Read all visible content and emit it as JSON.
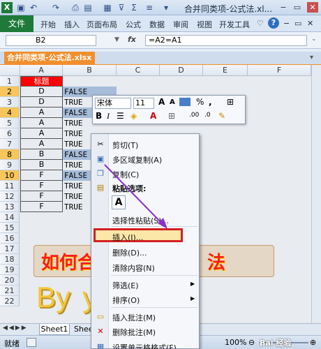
{
  "window": {
    "title": "合并同类项-公式法.xl...",
    "doc_tab": "合并同类项-公式法.xlsx"
  },
  "ribbon": {
    "file": "文件",
    "tabs": [
      "开始",
      "插入",
      "页面布局",
      "公式",
      "数据",
      "审阅",
      "视图",
      "开发工具"
    ]
  },
  "formula_bar": {
    "name_box": "B2",
    "fx": "fx",
    "formula": "=A2=A1"
  },
  "columns": [
    "A",
    "B",
    "C",
    "D",
    "E",
    "F"
  ],
  "rows": [
    {
      "n": "1",
      "a": "标题",
      "b": ""
    },
    {
      "n": "2",
      "a": "D",
      "b": "FALSE"
    },
    {
      "n": "3",
      "a": "D",
      "b": "TRUE"
    },
    {
      "n": "4",
      "a": "A",
      "b": "FALSE"
    },
    {
      "n": "5",
      "a": "A",
      "b": "TRUE"
    },
    {
      "n": "6",
      "a": "A",
      "b": "TRUE"
    },
    {
      "n": "7",
      "a": "A",
      "b": "TRUE"
    },
    {
      "n": "8",
      "a": "B",
      "b": "FALSE"
    },
    {
      "n": "9",
      "a": "B",
      "b": "TRUE"
    },
    {
      "n": "10",
      "a": "F",
      "b": "FALSE"
    },
    {
      "n": "11",
      "a": "F",
      "b": "TRUE"
    },
    {
      "n": "12",
      "a": "F",
      "b": "TRUE"
    },
    {
      "n": "13",
      "a": "F",
      "b": "TRUE"
    },
    {
      "n": "14",
      "a": "",
      "b": ""
    },
    {
      "n": "15",
      "a": "",
      "b": ""
    },
    {
      "n": "16",
      "a": "",
      "b": ""
    },
    {
      "n": "17",
      "a": "",
      "b": ""
    },
    {
      "n": "18",
      "a": "",
      "b": ""
    },
    {
      "n": "19",
      "a": "",
      "b": ""
    },
    {
      "n": "20",
      "a": "",
      "b": ""
    },
    {
      "n": "21",
      "a": "",
      "b": ""
    },
    {
      "n": "22",
      "a": "",
      "b": ""
    }
  ],
  "mini_toolbar": {
    "font": "宋体",
    "size": "11"
  },
  "context_menu": {
    "cut": "剪切(T)",
    "multi_copy": "多区域复制(A)",
    "copy": "复制(C)",
    "paste_options": "粘贴选项:",
    "paste_icon": "A",
    "paste_special": "选择性粘贴(S)...",
    "insert": "插入(I)...",
    "delete": "删除(D)...",
    "clear": "清除内容(N)",
    "filter": "筛选(E)",
    "sort": "排序(O)",
    "insert_comment": "插入批注(M)",
    "delete_comment": "删除批注(M)",
    "format_cells": "设置单元格格式(F)..."
  },
  "overlay": {
    "title": "如何合",
    "title_right": "法",
    "by": "By"
  },
  "sheets": {
    "tab1": "Sheet1",
    "tab2": "Shee"
  },
  "status": {
    "ready": "就绪",
    "zoom": "100%",
    "watermark": "Bai 经验"
  },
  "colors": {
    "file_tab": "#1f7a3a",
    "doc_tab": "#f18f2d",
    "title_cell": "#ff0000",
    "highlight_row": "#f6c65b",
    "insert_outline": "#d42020",
    "arrow": "#8b2fc9"
  }
}
